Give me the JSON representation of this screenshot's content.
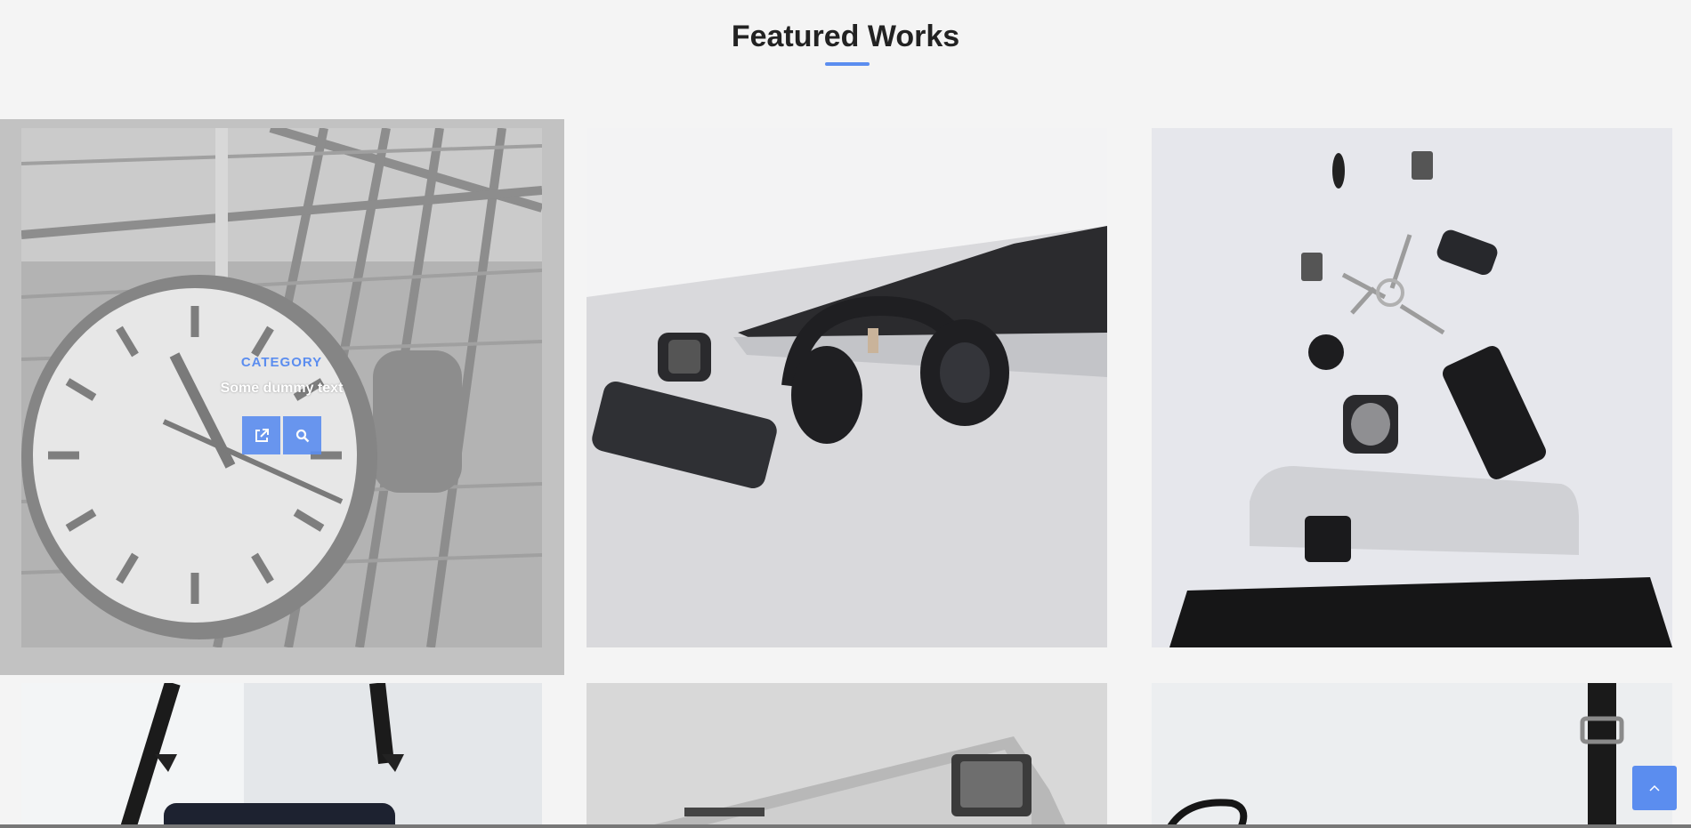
{
  "section": {
    "title": "Featured Works"
  },
  "portfolio": {
    "hover_item": {
      "category": "CATEGORY",
      "text": "Some dummy text",
      "buttons": [
        {
          "icon": "external-link-icon"
        },
        {
          "icon": "search-icon"
        }
      ]
    },
    "items": [
      {
        "subject": "station clock"
      },
      {
        "subject": "laptop and headphones"
      },
      {
        "subject": "keys, phone and bag"
      },
      {
        "subject": "instax camera"
      },
      {
        "subject": "vintage camera"
      },
      {
        "subject": "glasses and watch"
      }
    ]
  },
  "back_to_top": {
    "icon": "chevron-up-icon"
  },
  "colors": {
    "accent": "#5b8def",
    "background": "#f4f4f4",
    "heading": "#222222"
  }
}
